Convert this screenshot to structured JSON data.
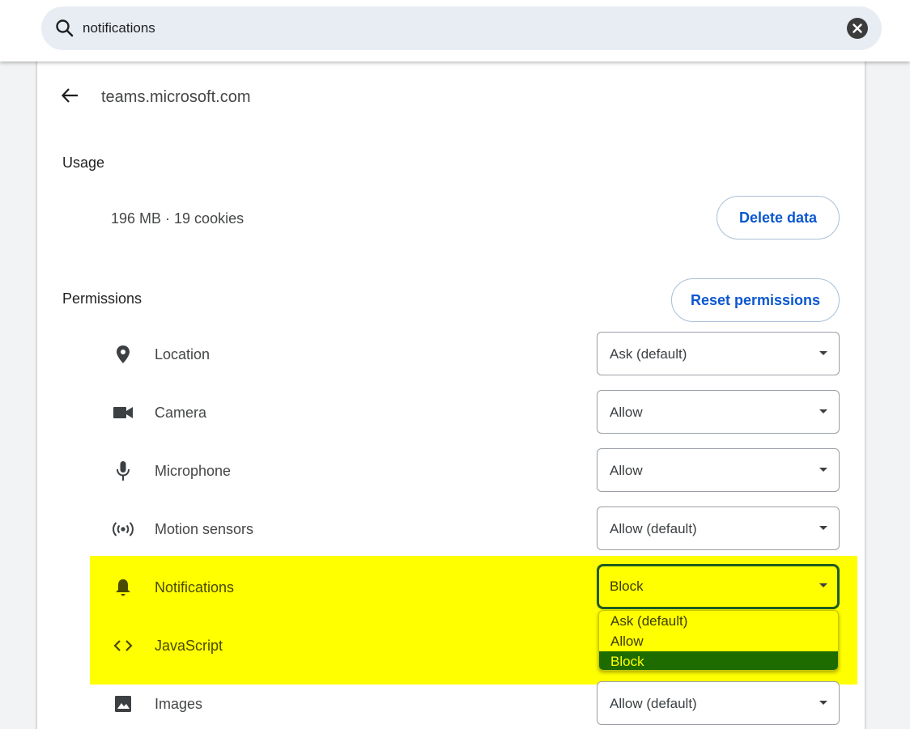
{
  "search": {
    "query": "notifications"
  },
  "header": {
    "site": "teams.microsoft.com"
  },
  "usage": {
    "label": "Usage",
    "summary": "196 MB · 19 cookies",
    "delete_button": "Delete data"
  },
  "permissions": {
    "label": "Permissions",
    "reset_button": "Reset permissions",
    "items": [
      {
        "label": "Location",
        "value": "Ask (default)",
        "icon": "location-pin-icon"
      },
      {
        "label": "Camera",
        "value": "Allow",
        "icon": "camera-icon"
      },
      {
        "label": "Microphone",
        "value": "Allow",
        "icon": "microphone-icon"
      },
      {
        "label": "Motion sensors",
        "value": "Allow (default)",
        "icon": "motion-sensors-icon"
      },
      {
        "label": "Notifications",
        "value": "Block",
        "icon": "bell-icon"
      },
      {
        "label": "JavaScript",
        "value": "",
        "icon": "code-brackets-icon"
      },
      {
        "label": "Images",
        "value": "Allow (default)",
        "icon": "image-icon"
      }
    ]
  },
  "dropdown": {
    "options": [
      "Ask (default)",
      "Allow",
      "Block"
    ],
    "selected": "Block"
  },
  "colors": {
    "highlight": "#ffff00",
    "selected_option_bg": "#1e6b00",
    "link_blue": "#0b57d0"
  }
}
